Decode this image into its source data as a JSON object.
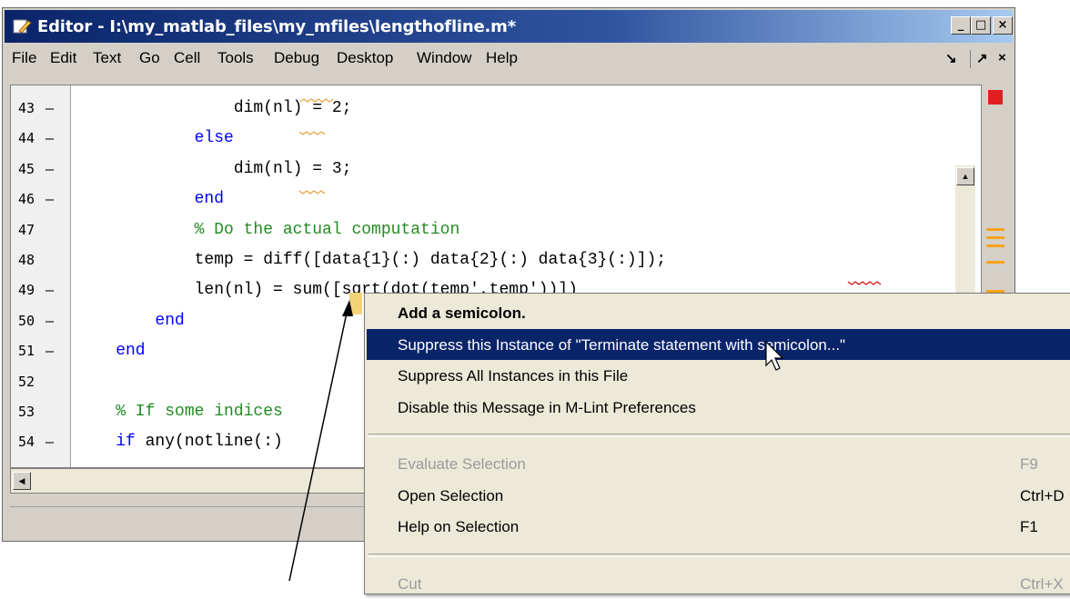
{
  "window": {
    "title": "Editor - I:\\my_matlab_files\\my_mfiles\\lengthofline.m*",
    "controls": {
      "minimize": "_",
      "maximize": "□",
      "close": "×"
    }
  },
  "menubar": {
    "items": [
      "File",
      "Edit",
      "Text",
      "Go",
      "Cell",
      "Tools",
      "Debug",
      "Desktop",
      "Window",
      "Help"
    ],
    "dock_icon": "↘",
    "undock_icon": "↗",
    "close_icon": "×"
  },
  "code_lines": [
    {
      "num": "43",
      "dash": "–",
      "segs": [
        {
          "t": "                dim(nl) = 2;",
          "c": ""
        }
      ]
    },
    {
      "num": "44",
      "dash": "–",
      "segs": [
        {
          "t": "            else",
          "c": "kw"
        }
      ]
    },
    {
      "num": "45",
      "dash": "–",
      "segs": [
        {
          "t": "                dim(nl) = 3;",
          "c": ""
        }
      ]
    },
    {
      "num": "46",
      "dash": "–",
      "segs": [
        {
          "t": "            end",
          "c": "kw"
        }
      ]
    },
    {
      "num": "47",
      "dash": "",
      "segs": [
        {
          "t": "            % Do the actual computation",
          "c": "cm"
        }
      ]
    },
    {
      "num": "48",
      "dash": "",
      "segs": [
        {
          "t": "            temp = diff([data{1}(:) data{2}(:) data{3}(:)]);",
          "c": ""
        }
      ]
    },
    {
      "num": "49",
      "dash": "–",
      "segs": [
        {
          "t": "            len(nl) = sum([sqrt(dot(temp',temp'))])",
          "c": ""
        }
      ]
    },
    {
      "num": "50",
      "dash": "–",
      "segs": [
        {
          "t": "        end",
          "c": "kw"
        }
      ]
    },
    {
      "num": "51",
      "dash": "–",
      "segs": [
        {
          "t": "    end",
          "c": "kw"
        }
      ]
    },
    {
      "num": "52",
      "dash": "",
      "segs": [
        {
          "t": "",
          "c": ""
        }
      ]
    },
    {
      "num": "53",
      "dash": "",
      "segs": [
        {
          "t": "    % If some indices",
          "c": "cm"
        }
      ]
    },
    {
      "num": "54",
      "dash": "–",
      "segs": [
        {
          "t": "    if",
          "c": "kw"
        },
        {
          "t": " any(notline(:)",
          "c": ""
        }
      ]
    }
  ],
  "context_menu": {
    "items": [
      {
        "label": "Add a semicolon.",
        "shortcut": "",
        "bold": true,
        "highlighted": false,
        "disabled": false
      },
      {
        "label": "Suppress this Instance of \"Terminate statement with semicolon...\"",
        "shortcut": "",
        "bold": false,
        "highlighted": true,
        "disabled": false
      },
      {
        "label": "Suppress All Instances in this File",
        "shortcut": "",
        "bold": false,
        "highlighted": false,
        "disabled": false
      },
      {
        "label": "Disable this Message in M-Lint Preferences",
        "shortcut": "",
        "bold": false,
        "highlighted": false,
        "disabled": false
      },
      {
        "separator": true
      },
      {
        "label": "Evaluate Selection",
        "shortcut": "F9",
        "bold": false,
        "highlighted": false,
        "disabled": true
      },
      {
        "label": "Open Selection",
        "shortcut": "Ctrl+D",
        "bold": false,
        "highlighted": false,
        "disabled": false
      },
      {
        "label": "Help on Selection",
        "shortcut": "F1",
        "bold": false,
        "highlighted": false,
        "disabled": false
      },
      {
        "separator": true
      },
      {
        "label": "Cut",
        "shortcut": "Ctrl+X",
        "bold": false,
        "highlighted": false,
        "disabled": true
      }
    ]
  },
  "colors": {
    "keyword": "#0000ff",
    "comment": "#228b22",
    "highlight": "#0a246a",
    "mlint_error": "#e02020",
    "mlint_warning": "#f7a21b"
  }
}
